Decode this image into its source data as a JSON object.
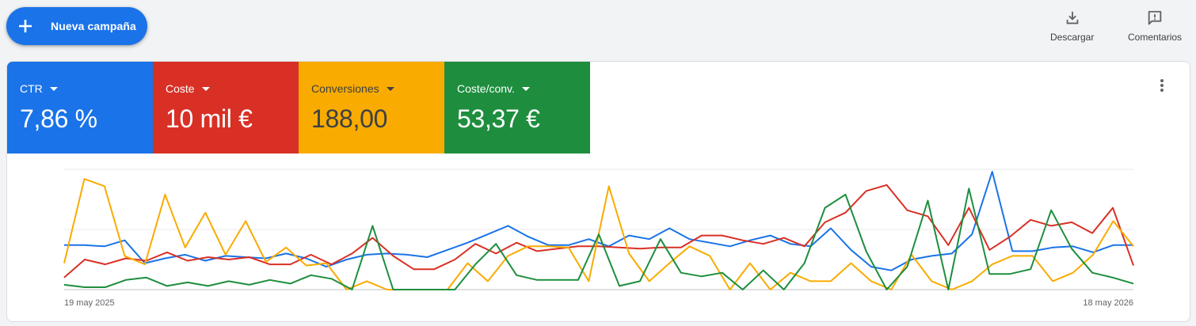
{
  "toolbar": {
    "new_campaign_label": "Nueva campaña",
    "download_label": "Descargar",
    "feedback_label": "Comentarios"
  },
  "scorecards": [
    {
      "name": "CTR",
      "value": "7,86 %",
      "color": "#1a73e8"
    },
    {
      "name": "Coste",
      "value": "10 mil €",
      "color": "#d93025"
    },
    {
      "name": "Conversiones",
      "value": "188,00",
      "color": "#f9ab00"
    },
    {
      "name": "Coste/conv.",
      "value": "53,37 €",
      "color": "#1e8e3e"
    }
  ],
  "chart_data": {
    "type": "line",
    "x_start_label": "19 may 2025",
    "x_end_label": "18 may 2026",
    "ylim": [
      0,
      100
    ],
    "gridlines": 3,
    "series": [
      {
        "name": "CTR",
        "color": "#1a73e8",
        "values": [
          37,
          37,
          36,
          41,
          22,
          26,
          29,
          24,
          28,
          27,
          26,
          30,
          26,
          19,
          25,
          29,
          30,
          29,
          27,
          33,
          39,
          46,
          53,
          44,
          37,
          37,
          42,
          36,
          45,
          42,
          51,
          42,
          39,
          36,
          41,
          45,
          38,
          36,
          51,
          33,
          19,
          16,
          25,
          28,
          30,
          46,
          98,
          32,
          32,
          35,
          36,
          31,
          37,
          37
        ]
      },
      {
        "name": "Coste",
        "color": "#d93025",
        "values": [
          10,
          25,
          21,
          26,
          24,
          31,
          24,
          27,
          25,
          27,
          21,
          21,
          29,
          21,
          30,
          43,
          28,
          17,
          17,
          25,
          38,
          30,
          39,
          32,
          34,
          36,
          36,
          35,
          34,
          35,
          35,
          45,
          45,
          41,
          38,
          43,
          36,
          56,
          64,
          82,
          87,
          66,
          61,
          37,
          68,
          33,
          44,
          58,
          53,
          56,
          47,
          68,
          20
        ]
      },
      {
        "name": "Conversiones",
        "color": "#f9ab00",
        "values": [
          22,
          92,
          86,
          28,
          21,
          79,
          35,
          64,
          29,
          57,
          23,
          35,
          20,
          22,
          0,
          7,
          0,
          0,
          0,
          0,
          22,
          7,
          28,
          36,
          36,
          35,
          7,
          86,
          30,
          7,
          22,
          36,
          28,
          0,
          22,
          0,
          14,
          7,
          7,
          22,
          7,
          0,
          29,
          7,
          0,
          7,
          21,
          28,
          28,
          7,
          14,
          29,
          57,
          36
        ]
      },
      {
        "name": "Coste/conv.",
        "color": "#1e8e3e",
        "values": [
          4,
          2,
          2,
          8,
          10,
          3,
          6,
          3,
          7,
          4,
          8,
          5,
          12,
          9,
          0,
          53,
          0,
          0,
          0,
          0,
          21,
          38,
          12,
          8,
          8,
          8,
          46,
          3,
          7,
          42,
          14,
          11,
          14,
          0,
          16,
          0,
          22,
          68,
          79,
          32,
          0,
          19,
          74,
          0,
          84,
          13,
          13,
          17,
          66,
          34,
          14,
          10,
          5
        ]
      }
    ]
  }
}
